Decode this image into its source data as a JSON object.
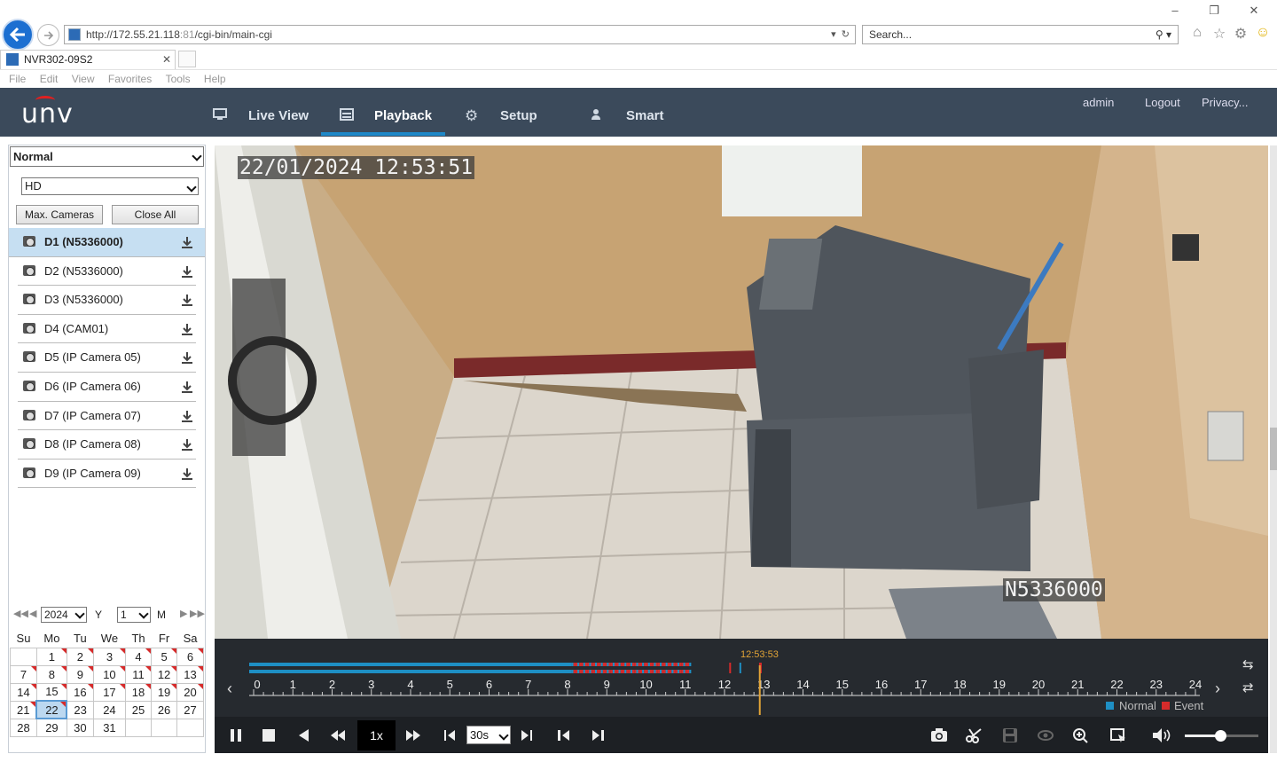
{
  "browser": {
    "url_host": "http://172.55.21.118",
    "url_port": ":81",
    "url_path": "/cgi-bin/main-cgi",
    "search_placeholder": "Search...",
    "tab_title": "NVR302-09S2",
    "menu": [
      "File",
      "Edit",
      "View",
      "Favorites",
      "Tools",
      "Help"
    ]
  },
  "header": {
    "logo": "unv",
    "nav": [
      {
        "label": "Live View",
        "icon": "monitor-icon"
      },
      {
        "label": "Playback",
        "icon": "calendar-icon",
        "active": true
      },
      {
        "label": "Setup",
        "icon": "gear-icon"
      },
      {
        "label": "Smart",
        "icon": "person-icon"
      }
    ],
    "user": "admin",
    "logout": "Logout",
    "privacy": "Privacy..."
  },
  "sidebar": {
    "mode": "Normal",
    "stream": "HD",
    "max_cameras": "Max. Cameras",
    "close_all": "Close All",
    "cameras": [
      {
        "label": "D1 (N5336000)",
        "selected": true
      },
      {
        "label": "D2 (N5336000)"
      },
      {
        "label": "D3 (N5336000)"
      },
      {
        "label": "D4 (CAM01)"
      },
      {
        "label": "D5 (IP Camera 05)"
      },
      {
        "label": "D6 (IP Camera 06)"
      },
      {
        "label": "D7 (IP Camera 07)"
      },
      {
        "label": "D8 (IP Camera 08)"
      },
      {
        "label": "D9 (IP Camera 09)"
      }
    ]
  },
  "calendar": {
    "year": "2024",
    "year_label": "Y",
    "month": "1",
    "month_label": "M",
    "weekdays": [
      "Su",
      "Mo",
      "Tu",
      "We",
      "Th",
      "Fr",
      "Sa"
    ],
    "weeks": [
      [
        "",
        "1",
        "2",
        "3",
        "4",
        "5",
        "6"
      ],
      [
        "7",
        "8",
        "9",
        "10",
        "11",
        "12",
        "13"
      ],
      [
        "14",
        "15",
        "16",
        "17",
        "18",
        "19",
        "20"
      ],
      [
        "21",
        "22",
        "23",
        "24",
        "25",
        "26",
        "27"
      ],
      [
        "28",
        "29",
        "30",
        "31",
        "",
        "",
        ""
      ]
    ],
    "today": "22",
    "recorded_days": [
      "1",
      "2",
      "3",
      "4",
      "5",
      "6",
      "7",
      "8",
      "9",
      "10",
      "11",
      "12",
      "13",
      "14",
      "15",
      "16",
      "17",
      "18",
      "19",
      "20",
      "21",
      "22"
    ]
  },
  "video": {
    "osd_time": "22/01/2024 12:53:51",
    "osd_name": "N5336000"
  },
  "timeline": {
    "cursor_time": "12:53:53",
    "hours": [
      "0",
      "1",
      "2",
      "3",
      "4",
      "5",
      "6",
      "7",
      "8",
      "9",
      "10",
      "11",
      "12",
      "13",
      "14",
      "15",
      "16",
      "17",
      "18",
      "19",
      "20",
      "21",
      "22",
      "23",
      "24"
    ],
    "legend_normal": "Normal",
    "legend_event": "Event",
    "normal_color": "#1e8fc4",
    "event_color": "#d62b2b"
  },
  "controls": {
    "speed": "1x",
    "interval": "30s"
  }
}
